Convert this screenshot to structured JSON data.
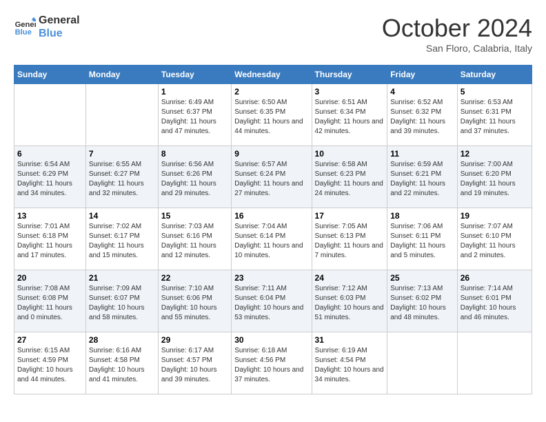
{
  "header": {
    "logo_line1": "General",
    "logo_line2": "Blue",
    "month": "October 2024",
    "location": "San Floro, Calabria, Italy"
  },
  "days_of_week": [
    "Sunday",
    "Monday",
    "Tuesday",
    "Wednesday",
    "Thursday",
    "Friday",
    "Saturday"
  ],
  "weeks": [
    [
      {
        "day": "",
        "content": ""
      },
      {
        "day": "",
        "content": ""
      },
      {
        "day": "1",
        "content": "Sunrise: 6:49 AM\nSunset: 6:37 PM\nDaylight: 11 hours and 47 minutes."
      },
      {
        "day": "2",
        "content": "Sunrise: 6:50 AM\nSunset: 6:35 PM\nDaylight: 11 hours and 44 minutes."
      },
      {
        "day": "3",
        "content": "Sunrise: 6:51 AM\nSunset: 6:34 PM\nDaylight: 11 hours and 42 minutes."
      },
      {
        "day": "4",
        "content": "Sunrise: 6:52 AM\nSunset: 6:32 PM\nDaylight: 11 hours and 39 minutes."
      },
      {
        "day": "5",
        "content": "Sunrise: 6:53 AM\nSunset: 6:31 PM\nDaylight: 11 hours and 37 minutes."
      }
    ],
    [
      {
        "day": "6",
        "content": "Sunrise: 6:54 AM\nSunset: 6:29 PM\nDaylight: 11 hours and 34 minutes."
      },
      {
        "day": "7",
        "content": "Sunrise: 6:55 AM\nSunset: 6:27 PM\nDaylight: 11 hours and 32 minutes."
      },
      {
        "day": "8",
        "content": "Sunrise: 6:56 AM\nSunset: 6:26 PM\nDaylight: 11 hours and 29 minutes."
      },
      {
        "day": "9",
        "content": "Sunrise: 6:57 AM\nSunset: 6:24 PM\nDaylight: 11 hours and 27 minutes."
      },
      {
        "day": "10",
        "content": "Sunrise: 6:58 AM\nSunset: 6:23 PM\nDaylight: 11 hours and 24 minutes."
      },
      {
        "day": "11",
        "content": "Sunrise: 6:59 AM\nSunset: 6:21 PM\nDaylight: 11 hours and 22 minutes."
      },
      {
        "day": "12",
        "content": "Sunrise: 7:00 AM\nSunset: 6:20 PM\nDaylight: 11 hours and 19 minutes."
      }
    ],
    [
      {
        "day": "13",
        "content": "Sunrise: 7:01 AM\nSunset: 6:18 PM\nDaylight: 11 hours and 17 minutes."
      },
      {
        "day": "14",
        "content": "Sunrise: 7:02 AM\nSunset: 6:17 PM\nDaylight: 11 hours and 15 minutes."
      },
      {
        "day": "15",
        "content": "Sunrise: 7:03 AM\nSunset: 6:16 PM\nDaylight: 11 hours and 12 minutes."
      },
      {
        "day": "16",
        "content": "Sunrise: 7:04 AM\nSunset: 6:14 PM\nDaylight: 11 hours and 10 minutes."
      },
      {
        "day": "17",
        "content": "Sunrise: 7:05 AM\nSunset: 6:13 PM\nDaylight: 11 hours and 7 minutes."
      },
      {
        "day": "18",
        "content": "Sunrise: 7:06 AM\nSunset: 6:11 PM\nDaylight: 11 hours and 5 minutes."
      },
      {
        "day": "19",
        "content": "Sunrise: 7:07 AM\nSunset: 6:10 PM\nDaylight: 11 hours and 2 minutes."
      }
    ],
    [
      {
        "day": "20",
        "content": "Sunrise: 7:08 AM\nSunset: 6:08 PM\nDaylight: 11 hours and 0 minutes."
      },
      {
        "day": "21",
        "content": "Sunrise: 7:09 AM\nSunset: 6:07 PM\nDaylight: 10 hours and 58 minutes."
      },
      {
        "day": "22",
        "content": "Sunrise: 7:10 AM\nSunset: 6:06 PM\nDaylight: 10 hours and 55 minutes."
      },
      {
        "day": "23",
        "content": "Sunrise: 7:11 AM\nSunset: 6:04 PM\nDaylight: 10 hours and 53 minutes."
      },
      {
        "day": "24",
        "content": "Sunrise: 7:12 AM\nSunset: 6:03 PM\nDaylight: 10 hours and 51 minutes."
      },
      {
        "day": "25",
        "content": "Sunrise: 7:13 AM\nSunset: 6:02 PM\nDaylight: 10 hours and 48 minutes."
      },
      {
        "day": "26",
        "content": "Sunrise: 7:14 AM\nSunset: 6:01 PM\nDaylight: 10 hours and 46 minutes."
      }
    ],
    [
      {
        "day": "27",
        "content": "Sunrise: 6:15 AM\nSunset: 4:59 PM\nDaylight: 10 hours and 44 minutes."
      },
      {
        "day": "28",
        "content": "Sunrise: 6:16 AM\nSunset: 4:58 PM\nDaylight: 10 hours and 41 minutes."
      },
      {
        "day": "29",
        "content": "Sunrise: 6:17 AM\nSunset: 4:57 PM\nDaylight: 10 hours and 39 minutes."
      },
      {
        "day": "30",
        "content": "Sunrise: 6:18 AM\nSunset: 4:56 PM\nDaylight: 10 hours and 37 minutes."
      },
      {
        "day": "31",
        "content": "Sunrise: 6:19 AM\nSunset: 4:54 PM\nDaylight: 10 hours and 34 minutes."
      },
      {
        "day": "",
        "content": ""
      },
      {
        "day": "",
        "content": ""
      }
    ]
  ]
}
